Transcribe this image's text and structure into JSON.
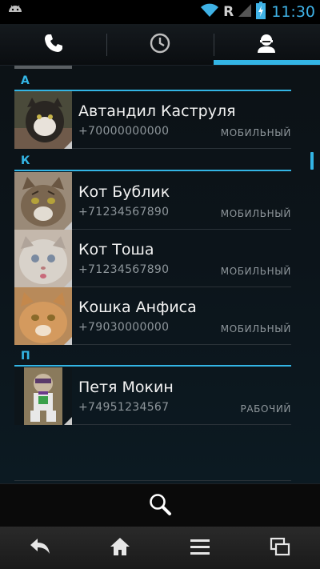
{
  "status_bar": {
    "icons": [
      "android-notification-icon",
      "wifi-icon",
      "roaming-icon",
      "signal-icon",
      "battery-charging-icon"
    ],
    "roaming_label": "R",
    "time": "11:30"
  },
  "tabs": [
    {
      "name": "phone",
      "icon": "phone-icon",
      "active": false
    },
    {
      "name": "call-log",
      "icon": "clock-icon",
      "active": false
    },
    {
      "name": "contacts",
      "icon": "person-icon",
      "active": true
    }
  ],
  "sections": [
    {
      "letter": "А"
    },
    {
      "letter": "К"
    },
    {
      "letter": "П"
    }
  ],
  "contacts": [
    {
      "name": "Автандил Каструля",
      "number": "+70000000000",
      "type": "МОБИЛЬНЫЙ",
      "photo_color": "#5b4e42"
    },
    {
      "name": "Кот Бублик",
      "number": "+71234567890",
      "type": "МОБИЛЬНЫЙ",
      "photo_color": "#8a7560"
    },
    {
      "name": "Кот Тоша",
      "number": "+71234567890",
      "type": "МОБИЛЬНЫЙ",
      "photo_color": "#b8aaa0"
    },
    {
      "name": "Кошка Анфиса",
      "number": "+79030000000",
      "type": "МОБИЛЬНЫЙ",
      "photo_color": "#c98a4e"
    },
    {
      "name": "Петя Мокин",
      "number": "+74951234567",
      "type": "РАБОЧИЙ",
      "photo_color": "#7a6a4c"
    }
  ],
  "search": {
    "icon": "search-icon"
  },
  "nav_bar": {
    "buttons": [
      "back-icon",
      "home-icon",
      "menu-icon",
      "recent-apps-icon"
    ]
  },
  "colors": {
    "accent": "#33b5e5",
    "secondary_text": "#8e969b"
  }
}
